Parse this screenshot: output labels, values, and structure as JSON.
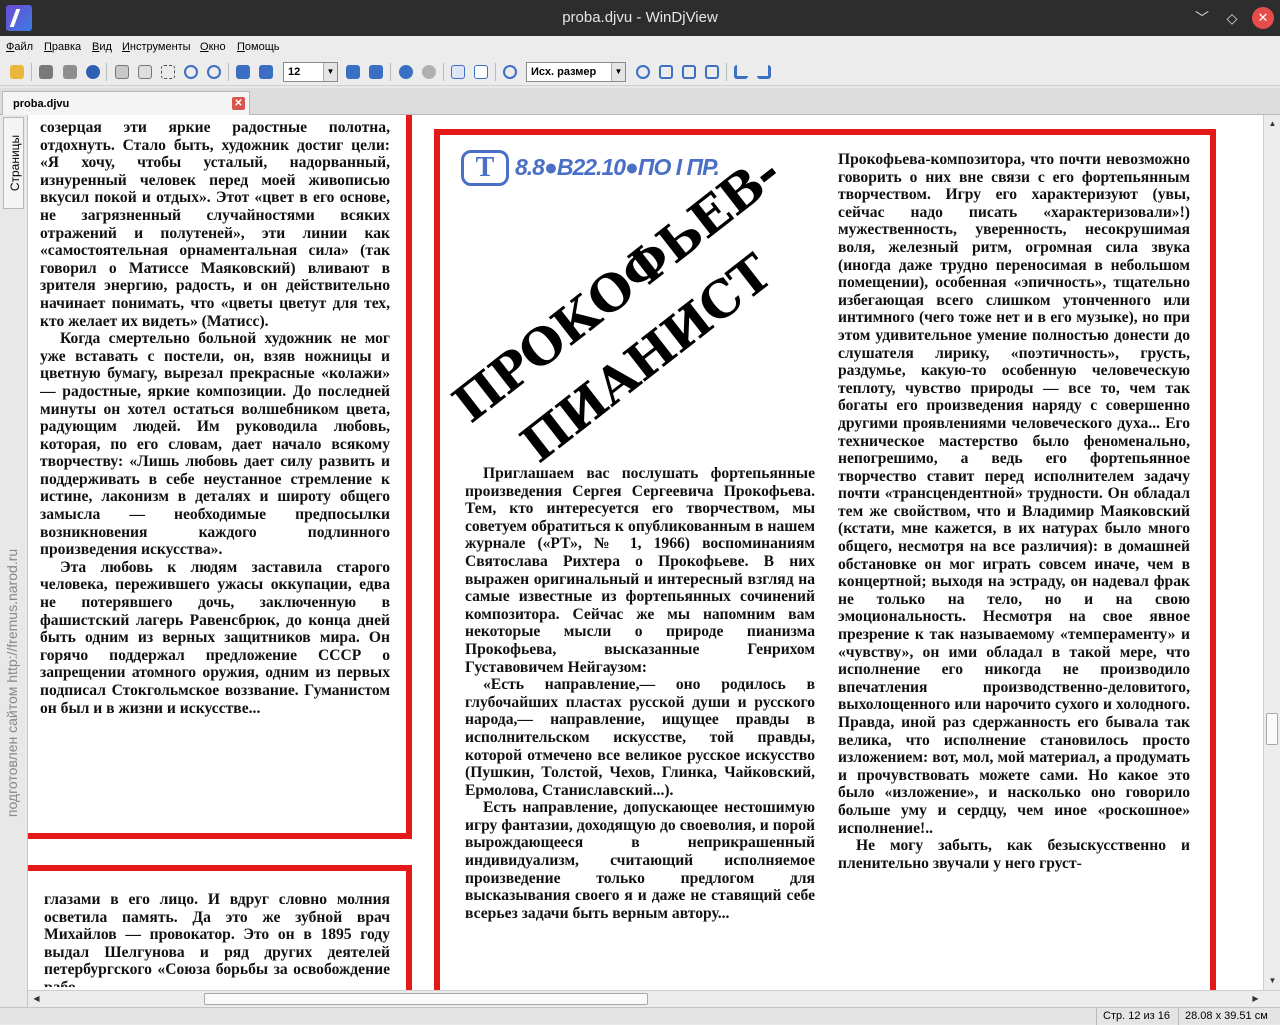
{
  "window": {
    "title": "proba.djvu - WinDjView"
  },
  "menu": [
    "Файл",
    "Правка",
    "Вид",
    "Инструменты",
    "Окно",
    "Помощь"
  ],
  "toolbar": {
    "page_number": "12",
    "zoom": "Исх. размер"
  },
  "tab": {
    "label": "proba.djvu"
  },
  "sidepanel": {
    "tab_label": "Страницы"
  },
  "watermark": "подготовлен сайтом http://fremus.narod.ru",
  "status": {
    "page": "Стр. 12 из 16",
    "size": "28.08 x 39.51 см"
  },
  "article": {
    "schedule": "8.8●В22.10●ПО I ПР.",
    "tv_letter": "Т",
    "headline_line1": "ПРОКОФЬЕВ-",
    "headline_line2": "ПИАНИСТ",
    "left_col_top": "созерцая эти яркие радостные полотна, отдохнуть. Стало быть, художник достиг цели: «Я хочу, чтобы усталый, надорванный, изнуренный человек перед моей живописью вкусил покой и отдых». Этот «цвет в его основе, не загрязненный случайностями всяких отражений и полутеней», эти линии как «самостоятельная орнаментальная сила» (так говорил о Матиссе Маяковский) вливают в зрителя энергию, радость, и он действительно начинает понимать, что «цветы цветут для тех, кто желает их видеть» (Матисс).",
    "left_col_p2": "Когда смертельно больной художник не мог уже вставать с постели, он, взяв ножницы и цветную бумагу, вырезал прекрасные «колажи» — радостные, яркие композиции. До последней минуты он хотел остаться волшебником цвета, радующим людей. Им руководила любовь, которая, по его словам, дает начало всякому творчеству: «Лишь любовь дает силу развить и поддерживать в себе неустанное стремление к истине, лаконизм в деталях и широту общего замысла — необходимые предпосылки возникновения каждого подлинного произведения искусства».",
    "left_col_p3": "Эта любовь к людям заставила старого человека, пережившего ужасы оккупации, едва не потерявшего дочь, заключенную в фашистский лагерь Равенсбрюк, до конца дней быть одним из верных защитников мира. Он горячо поддержал предложение СССР о запрещении атомного оружия, одним из первых подписал Стокгольмское воззвание. Гуманистом он был и в жизни и искусстве...",
    "left_col_bottom": "глазами в его лицо. И вдруг словно молния осветила память. Да это же зубной врач Михайлов — провокатор. Это он в 1895 году выдал Шелгунова и ряд других деятелей петербургского «Союза борьбы за освобождение рабо-",
    "middle_col_p1": "Приглашаем вас послушать фортепьянные произведения Сергея Сергеевича Прокофьева. Тем, кто интересуется его творчеством, мы советуем обратиться к опубликованным в нашем журнале («РТ», № 1, 1966) воспоминаниям Святослава Рихтера о Прокофьеве. В них выражен оригинальный и интересный взгляд на самые известные из фортепьянных сочинений композитора. Сейчас же мы напомним вам некоторые мысли о природе пианизма Прокофьева, высказанные Генрихом Густавовичем Нейгаузом:",
    "middle_col_p2": "«Есть направление,— оно родилось в глубочайших пластах русской души и русского народа,— направление, ищущее правды в исполнительском искусстве, той правды, которой отмечено все великое русское искусство (Пушкин, Толстой, Чехов, Глинка, Чайковский, Ермолова, Станиславский...).",
    "middle_col_p3": "Есть направление, допускающее нестошимую игру фантазии, доходящую до своеволия, и порой вырождающееся в неприкрашенный индивидуализм, считающий исполняемое произведение только предлогом для высказывания своего я и даже не ставящий себе всерьез задачи быть верным автору...",
    "right_col_p1": "Прокофьева-композитора, что почти невозможно говорить о них вне связи с его фортепьянным творчеством. Игру его характеризуют (увы, сейчас надо писать «характеризовали»!) мужественность, уверенность, несокрушимая воля, железный ритм, огромная сила звука (иногда даже трудно переносимая в небольшом помещении), особенная «эпичность», тщательно избегающая всего слишком утонченного или интимного (чего тоже нет и в его музыке), но при этом удивительное умение полностью донести до слушателя лирику, «поэтичность», грусть, раздумье, какую-то особенную человеческую теплоту, чувство природы — все то, чем так богаты его произведения наряду с совершенно другими проявлениями человеческого духа... Его техническое мастерство было феноменально, непогрешимо, а ведь его фортепьянное творчество ставит перед исполнителем задачу почти «трансцендентной» трудности. Он обладал тем же свойством, что и Владимир Маяковский (кстати, мне кажется, в их натурах было много общего, несмотря на все различия): в домашней обстановке он мог играть совсем иначе, чем в концертной; выходя на эстраду, он надевал фрак не только на тело, но и на свою эмоциональность. Несмотря на свое явное презрение к так называемому «темпераменту» и «чувству», он ими обладал в такой мере, что исполнение его никогда не производило впечатления производственно-деловитого, выхолощенного или нарочито сухого и холодного. Правда, иной раз сдержанность его бывала так велика, что исполнение становилось просто изложением: вот, мол, мой материал, а продумать и прочувствовать можете сами. Но какое это было «изложение», и насколько оно говорило больше уму и сердцу, чем иное «роскошное» исполнение!..",
    "right_col_p2": "Не могу забыть, как безыскусственно и пленительно звучали у него груст-"
  }
}
